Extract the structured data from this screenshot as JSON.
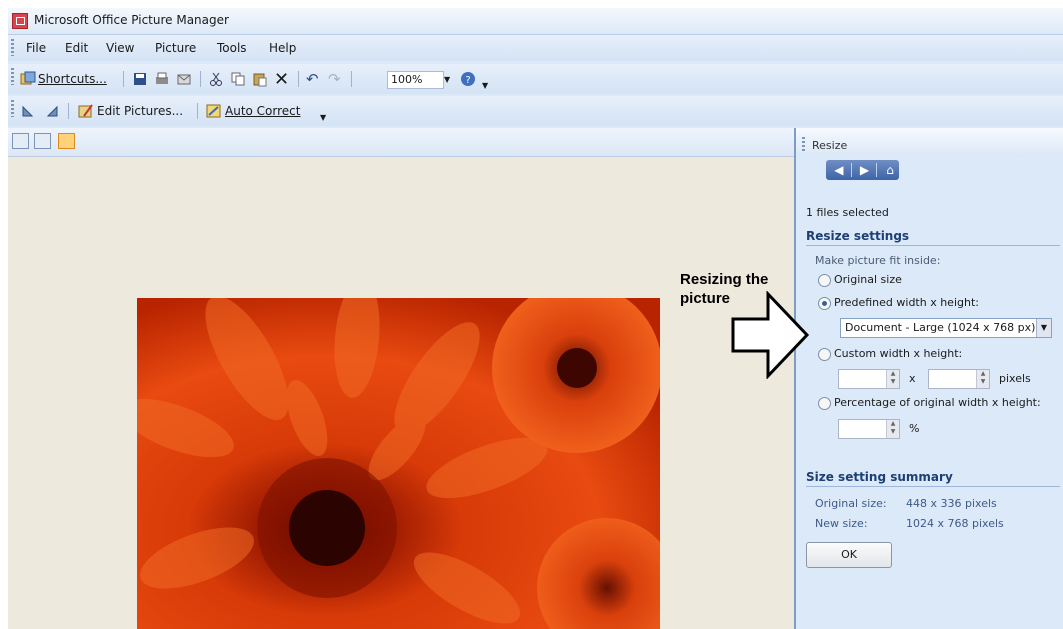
{
  "window": {
    "title": "Microsoft Office Picture Manager"
  },
  "menu": [
    "File",
    "Edit",
    "View",
    "Picture",
    "Tools",
    "Help"
  ],
  "toolbar": {
    "shortcuts_label": "Shortcuts...",
    "zoom_value": "100%"
  },
  "toolbar2": {
    "edit_pictures_label": "Edit Pictures...",
    "auto_correct_label": "Auto Correct"
  },
  "panel": {
    "title": "Resize",
    "files_selected": "1 files selected",
    "resize_settings_heading": "Resize settings",
    "fit_inside_label": "Make picture fit inside:",
    "options": {
      "original": "Original size",
      "predefined": "Predefined width x height:",
      "custom": "Custom width x height:",
      "percentage": "Percentage of original width x height:"
    },
    "selected_option": "predefined",
    "predefined_value": "Document - Large (1024 x 768 px)",
    "x_label": "x",
    "pixels_label": "pixels",
    "percent_label": "%",
    "summary_heading": "Size setting summary",
    "original_size_label": "Original size:",
    "original_size_value": "448 x 336 pixels",
    "new_size_label": "New size:",
    "new_size_value": "1024 x 768 pixels",
    "ok_label": "OK"
  },
  "annotation": {
    "line1": "Resizing the",
    "line2": "picture"
  }
}
